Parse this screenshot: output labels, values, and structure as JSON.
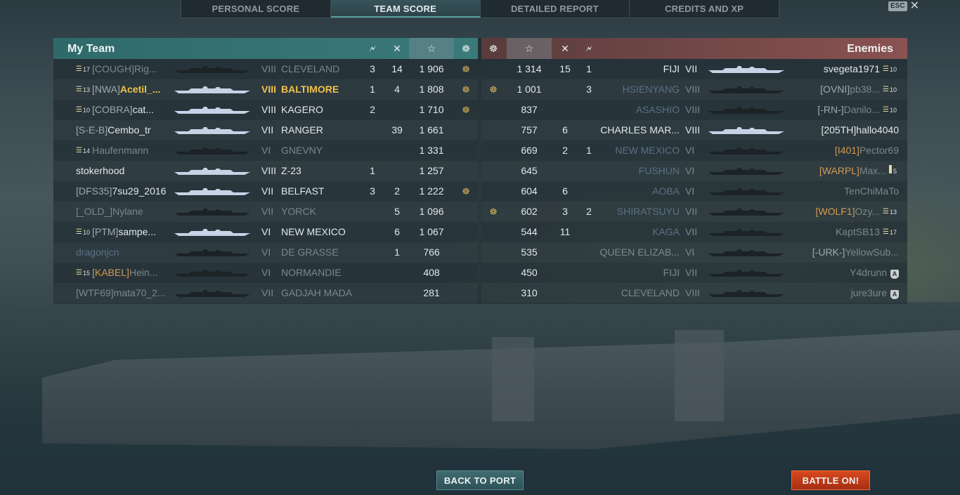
{
  "tabs": [
    {
      "label": "PERSONAL SCORE",
      "active": false
    },
    {
      "label": "TEAM SCORE",
      "active": true
    },
    {
      "label": "DETAILED REPORT",
      "active": false
    },
    {
      "label": "CREDITS AND XP",
      "active": false
    }
  ],
  "esc_label": "ESC",
  "esc_close": "✕",
  "left": {
    "title": "My Team",
    "header_icons": [
      "🗲",
      "✕",
      "☆",
      "☸"
    ],
    "rows": [
      {
        "rank": "17",
        "clan": "[COUGH]",
        "name": "Rig...",
        "tier": "VIII",
        "ship": "CLEVELAND",
        "kills": "3",
        "planes": "14",
        "score": "1 906",
        "medal": true,
        "style": "dim"
      },
      {
        "rank": "13",
        "clan": "[NWA]",
        "name": "Acetil_...",
        "tier": "VIII",
        "ship": "BALTIMORE",
        "kills": "1",
        "planes": "4",
        "score": "1 808",
        "medal": true,
        "style": "hi"
      },
      {
        "rank": "10",
        "clan": "[COBRA]",
        "name": "cat...",
        "tier": "VIII",
        "ship": "KAGERO",
        "kills": "2",
        "planes": "",
        "score": "1 710",
        "medal": true,
        "style": "bright"
      },
      {
        "rank": "",
        "clan": "[S-E-B]",
        "name": "Cembo_tr",
        "tier": "VII",
        "ship": "RANGER",
        "kills": "",
        "planes": "39",
        "score": "1 661",
        "medal": false,
        "style": "bright"
      },
      {
        "rank": "14",
        "clan": "",
        "name": "Haufenmann",
        "tier": "VI",
        "ship": "GNEVNY",
        "kills": "",
        "planes": "",
        "score": "1 331",
        "medal": false,
        "style": "dim"
      },
      {
        "rank": "",
        "clan": "",
        "name": "stokerhood",
        "tier": "VIII",
        "ship": "Z-23",
        "kills": "1",
        "planes": "",
        "score": "1 257",
        "medal": false,
        "style": "bright"
      },
      {
        "rank": "",
        "clan": "[DFS35]",
        "name": "7su29_2016",
        "tier": "VII",
        "ship": "BELFAST",
        "kills": "3",
        "planes": "2",
        "score": "1 222",
        "medal": true,
        "style": "bright"
      },
      {
        "rank": "",
        "clan": "[_OLD_]",
        "name": "Nylane",
        "tier": "VII",
        "ship": "YORCK",
        "kills": "",
        "planes": "5",
        "score": "1 096",
        "medal": false,
        "style": "dim"
      },
      {
        "rank": "10",
        "clan": "[PTM]",
        "name": "sampe...",
        "tier": "VI",
        "ship": "NEW MEXICO",
        "kills": "",
        "planes": "6",
        "score": "1 067",
        "medal": false,
        "style": "bright"
      },
      {
        "rank": "",
        "clan": "",
        "name": "dragonjcn",
        "tier": "VI",
        "ship": "DE GRASSE",
        "kills": "",
        "planes": "1",
        "score": "766",
        "medal": false,
        "style": "dim"
      },
      {
        "rank": "15",
        "clan": "[KABEL]",
        "name": "Hein...",
        "tier": "VI",
        "ship": "NORMANDIE",
        "kills": "",
        "planes": "",
        "score": "408",
        "medal": false,
        "style": "dim"
      },
      {
        "rank": "",
        "clan": "[WTF69]",
        "name": "mata70_2...",
        "tier": "VII",
        "ship": "GADJAH MADA",
        "kills": "",
        "planes": "",
        "score": "281",
        "medal": false,
        "style": "dim"
      }
    ]
  },
  "right": {
    "title": "Enemies",
    "header_icons": [
      "☸",
      "☆",
      "✕",
      "🗲"
    ],
    "rows": [
      {
        "medal": false,
        "score": "1 314",
        "planes": "15",
        "kills": "1",
        "ship": "FIJI",
        "tier": "VII",
        "clan": "",
        "name": "svegeta1971",
        "rank": "10",
        "style": "bright"
      },
      {
        "medal": true,
        "score": "1 001",
        "planes": "",
        "kills": "3",
        "ship": "HSIENYANG",
        "tier": "VIII",
        "clan": "[OVNI]",
        "name": "pb38...",
        "rank": "10",
        "style": "dim"
      },
      {
        "medal": false,
        "score": "837",
        "planes": "",
        "kills": "",
        "ship": "ASASHIO",
        "tier": "VIII",
        "clan": "[-RN-]",
        "name": "Danilo...",
        "rank": "10",
        "style": "dim"
      },
      {
        "medal": false,
        "score": "757",
        "planes": "6",
        "kills": "",
        "ship": "CHARLES MAR...",
        "tier": "VIII",
        "clan": "[205TH]",
        "name": "hallo4040",
        "rank": "",
        "style": "bright"
      },
      {
        "medal": false,
        "score": "669",
        "planes": "2",
        "kills": "1",
        "ship": "NEW MEXICO",
        "tier": "VI",
        "clan": "[I401]",
        "name": "Pector69",
        "rank": "",
        "style": "dim"
      },
      {
        "medal": false,
        "score": "645",
        "planes": "",
        "kills": "",
        "ship": "FUSHUN",
        "tier": "VI",
        "clan": "[WARPL]",
        "name": "Max...",
        "rank": "5",
        "style": "dim"
      },
      {
        "medal": false,
        "score": "604",
        "planes": "6",
        "kills": "",
        "ship": "AOBA",
        "tier": "VI",
        "clan": "",
        "name": "TenChiMaTo",
        "rank": "",
        "style": "dim"
      },
      {
        "medal": true,
        "score": "602",
        "planes": "3",
        "kills": "2",
        "ship": "SHIRATSUYU",
        "tier": "VII",
        "clan": "[WOLF1]",
        "name": "Ozy...",
        "rank": "13",
        "style": "dim"
      },
      {
        "medal": false,
        "score": "544",
        "planes": "11",
        "kills": "",
        "ship": "KAGA",
        "tier": "VII",
        "clan": "",
        "name": "KaptSB13",
        "rank": "17",
        "style": "dim"
      },
      {
        "medal": false,
        "score": "535",
        "planes": "",
        "kills": "",
        "ship": "QUEEN ELIZAB...",
        "tier": "VI",
        "clan": "[-URK-]",
        "name": "YellowSub...",
        "rank": "",
        "style": "dim"
      },
      {
        "medal": false,
        "score": "450",
        "planes": "",
        "kills": "",
        "ship": "FIJI",
        "tier": "VII",
        "clan": "",
        "name": "Y4drunn",
        "rank": "A",
        "style": "dim"
      },
      {
        "medal": false,
        "score": "310",
        "planes": "",
        "kills": "",
        "ship": "CLEVELAND",
        "tier": "VIII",
        "clan": "",
        "name": "jure3ure",
        "rank": "A",
        "style": "dim"
      }
    ]
  },
  "buttons": {
    "back": "BACK TO PORT",
    "battle": "BATTLE ON!"
  }
}
